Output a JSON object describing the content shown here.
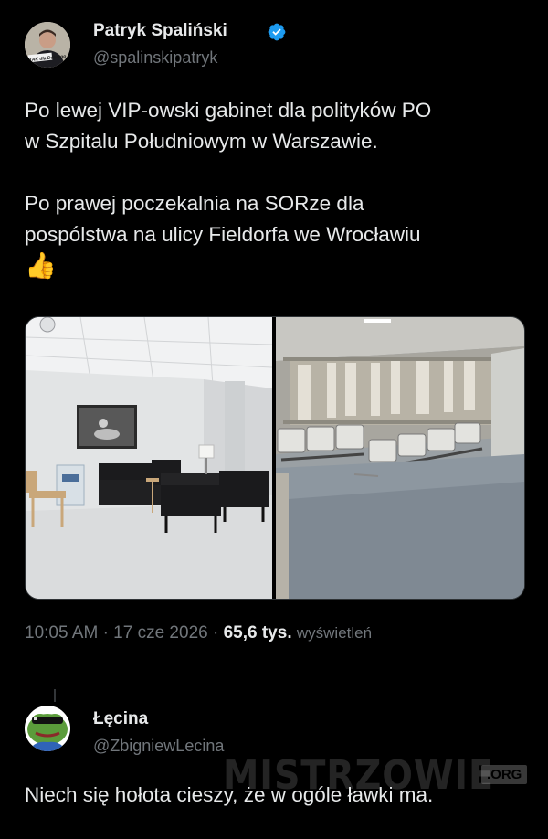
{
  "tweet": {
    "author": {
      "name": "Patryk Spaliński",
      "handle": "@spalinskipatryk",
      "verified": true,
      "avatar_badge": "TAK dla Dobrego"
    },
    "text_lines": [
      "Po lewej VIP-owski gabinet dla polityków PO",
      "w Szpitalu Południowym w Warszawie.",
      "Po prawej poczekalnia na SORze dla",
      "pospólstwa na ulicy Fieldorfa we Wrocławiu"
    ],
    "emoji": "👍",
    "media": {
      "left_photo": "office-lounge-photo",
      "right_photo": "waiting-room-photo"
    },
    "meta": {
      "time": "10:05 AM",
      "date": "17 cze 2026",
      "views_count": "65,6 tys.",
      "views_label": "wyświetleń"
    }
  },
  "reply": {
    "author": {
      "name": "Łęcina",
      "handle": "@ZbigniewLecina"
    },
    "text": "Niech się hołota cieszy, że w ogóle ławki ma."
  },
  "watermark": {
    "brand": "MISTRZOWIE",
    "suffix": ".ORG"
  },
  "colors": {
    "background": "#000000",
    "text": "#e7e9ea",
    "secondary": "#71767b",
    "verified": "#1d9bf0",
    "divider": "#2f3336"
  }
}
